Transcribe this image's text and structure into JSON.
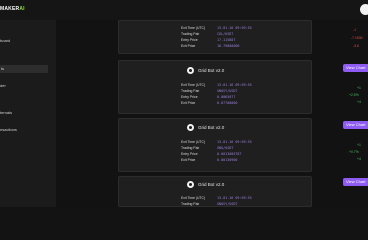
{
  "brand": {
    "name": "MAKER",
    "ai": "AI"
  },
  "sidebar": {
    "items": [
      "board",
      "ts",
      "der",
      "ternals",
      "nsactions"
    ]
  },
  "cards": [
    {
      "title": "",
      "rows": [
        {
          "label": "Exit Time (UTC)",
          "value": "13-01-16 09:59:55"
        },
        {
          "label": "Trading Pair",
          "value": "COL/USDT"
        },
        {
          "label": "Entry Price",
          "value": "17.115807"
        },
        {
          "label": "Exit Price",
          "value": "16.79800000"
        }
      ]
    },
    {
      "title": "Grid Bot v2.0",
      "button": "View Chart",
      "rows": [
        {
          "label": "Exit Time (UTC)",
          "value": "13-01-16 09:59:55"
        },
        {
          "label": "Trading Pair",
          "value": "GNOSY/USDT"
        },
        {
          "label": "Entry Price",
          "value": "0.0065077"
        },
        {
          "label": "Exit Price",
          "value": "0.07700000"
        }
      ]
    },
    {
      "title": "Grid Bot v2.0",
      "button": "View Chart",
      "rows": [
        {
          "label": "Exit Time (UTC)",
          "value": "13-01-16 09:59:55"
        },
        {
          "label": "Trading Pair",
          "value": "GNO/USDT"
        },
        {
          "label": "Entry Price",
          "value": "0.0013005787"
        },
        {
          "label": "Exit Price",
          "value": "0.00130900"
        }
      ]
    },
    {
      "title": "Grid Bot v2.0",
      "button": "View Chart",
      "rows": [
        {
          "label": "Exit Time (UTC)",
          "value": "13-01-16 09:59:55"
        },
        {
          "label": "Trading Pair",
          "value": "GNOSY/USDT"
        }
      ]
    }
  ],
  "pnl": [
    {
      "type": "loss",
      "lines": [
        "-1",
        "-7.1530",
        "-3.6"
      ]
    },
    {
      "type": "gain",
      "lines": [
        "+1",
        "+2.5%",
        "+4"
      ]
    },
    {
      "type": "gain",
      "lines": [
        "+1",
        "+0.7%",
        "+4"
      ]
    }
  ]
}
